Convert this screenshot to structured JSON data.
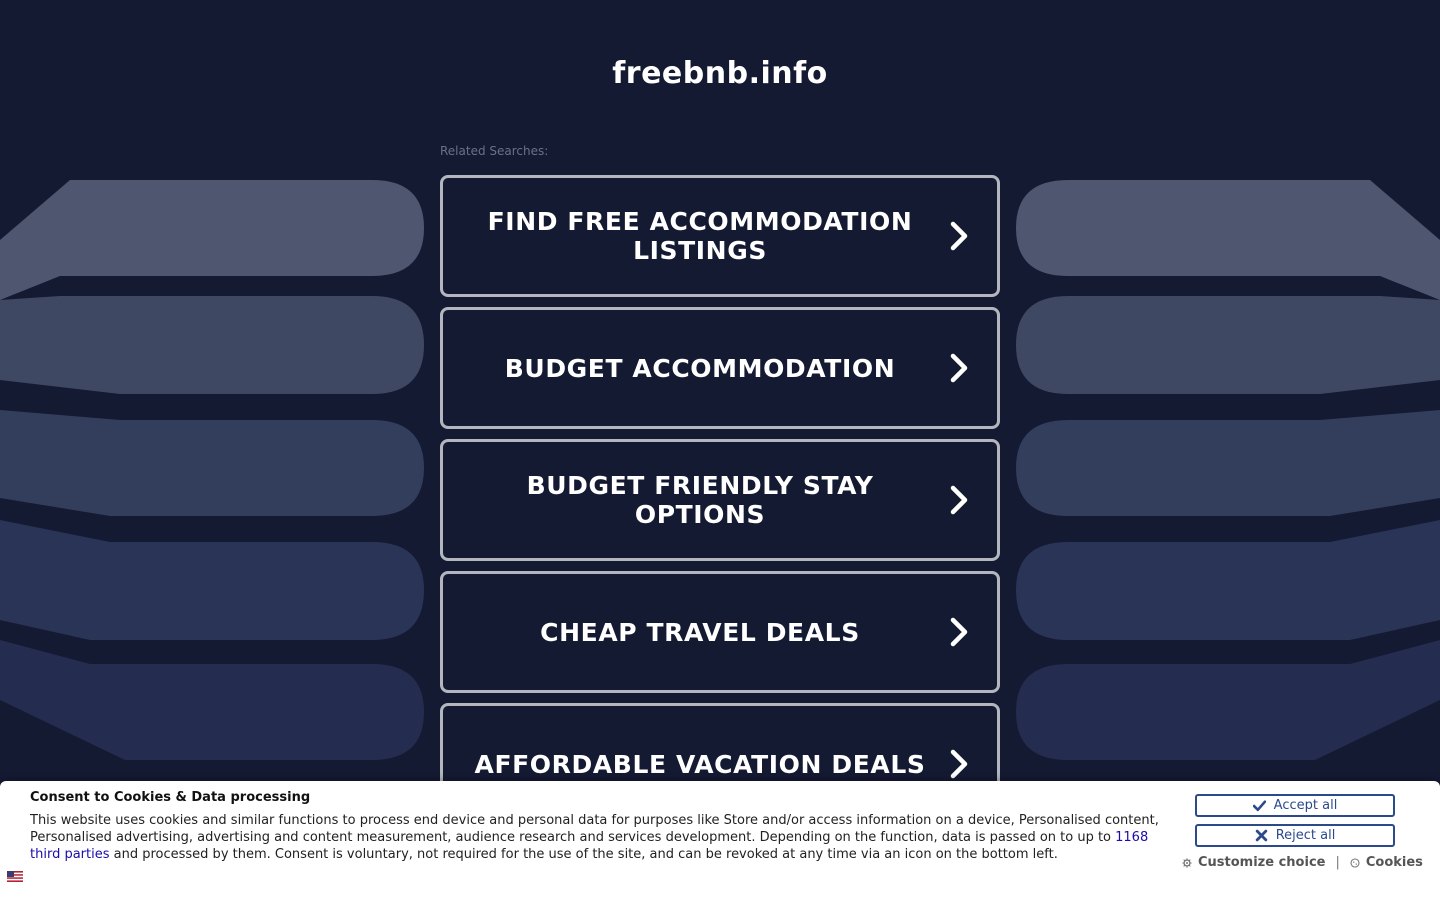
{
  "domain_title": "freebnb.info",
  "related_label": "Related Searches:",
  "links": [
    {
      "label": "FIND FREE ACCOMMODATION LISTINGS"
    },
    {
      "label": "BUDGET ACCOMMODATION"
    },
    {
      "label": "BUDGET FRIENDLY STAY OPTIONS"
    },
    {
      "label": "CHEAP TRAVEL DEALS"
    },
    {
      "label": "AFFORDABLE VACATION DEALS"
    }
  ],
  "consent": {
    "title": "Consent to Cookies & Data processing",
    "body_part1": "This website uses cookies and similar functions to process end device and personal data for purposes like Store and/or access information on a device, Personalised content, Personalised advertising, advertising and content measurement, audience research and services development. Depending on the function, data is passed on to up to ",
    "third_parties_link": "1168 third parties",
    "body_part2": " and processed by them. Consent is voluntary, not required for the use of the site, and can be revoked at any time via an icon on the bottom left.",
    "accept_label": "Accept all",
    "reject_label": "Reject all",
    "customize_label": "Customize choice",
    "separator": "|",
    "cookies_label": "Cookies"
  },
  "colors": {
    "background": "#151a33",
    "link_border": "#b4b6bf",
    "button_accent": "#2b4a8c"
  }
}
